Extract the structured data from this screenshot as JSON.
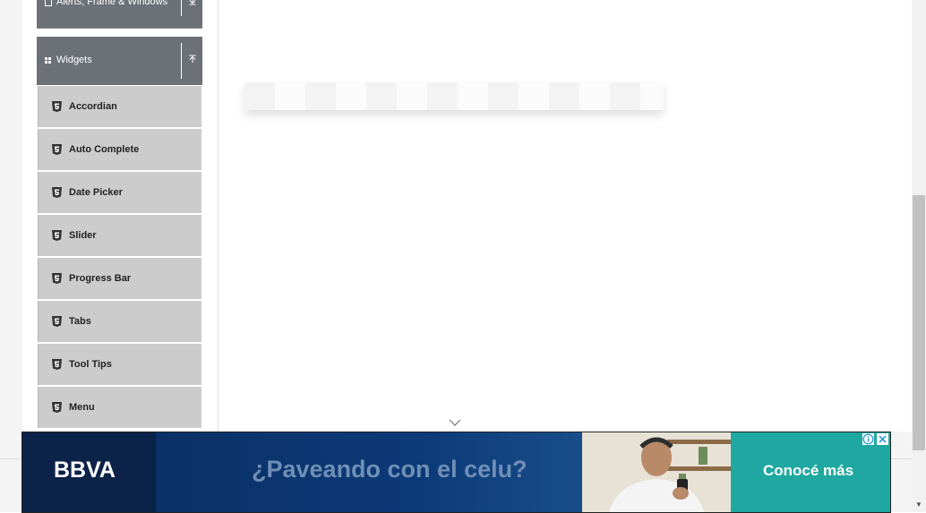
{
  "sidebar": {
    "groups": [
      {
        "label": "Alerts, Frame & Windows",
        "icon": "window-icon",
        "toggle_icon": "expand-down-icon"
      },
      {
        "label": "Widgets",
        "icon": "grid-icon",
        "toggle_icon": "collapse-up-icon"
      }
    ],
    "widgets_items": [
      {
        "label": "Accordian",
        "icon": "html5-icon"
      },
      {
        "label": "Auto Complete",
        "icon": "html5-icon"
      },
      {
        "label": "Date Picker",
        "icon": "html5-icon"
      },
      {
        "label": "Slider",
        "icon": "html5-icon"
      },
      {
        "label": "Progress Bar",
        "icon": "html5-icon"
      },
      {
        "label": "Tabs",
        "icon": "html5-icon"
      },
      {
        "label": "Tool Tips",
        "icon": "html5-icon"
      },
      {
        "label": "Menu",
        "icon": "html5-icon"
      }
    ]
  },
  "main": {
    "scroll_indicator_icon": "chevron-down-icon"
  },
  "ad": {
    "brand": "BBVA",
    "headline": "¿Paveando con el celu?",
    "cta": "Conocé más",
    "info_icon": "info-icon",
    "close_icon": "close-icon",
    "colors": {
      "brand_panel": "#0c2349",
      "banner": "#0b3166",
      "cta": "#1fa8a1",
      "headline": "#6f8fb6"
    }
  },
  "colors": {
    "group_header": "#6c7178",
    "menu_item": "#cccccc"
  }
}
